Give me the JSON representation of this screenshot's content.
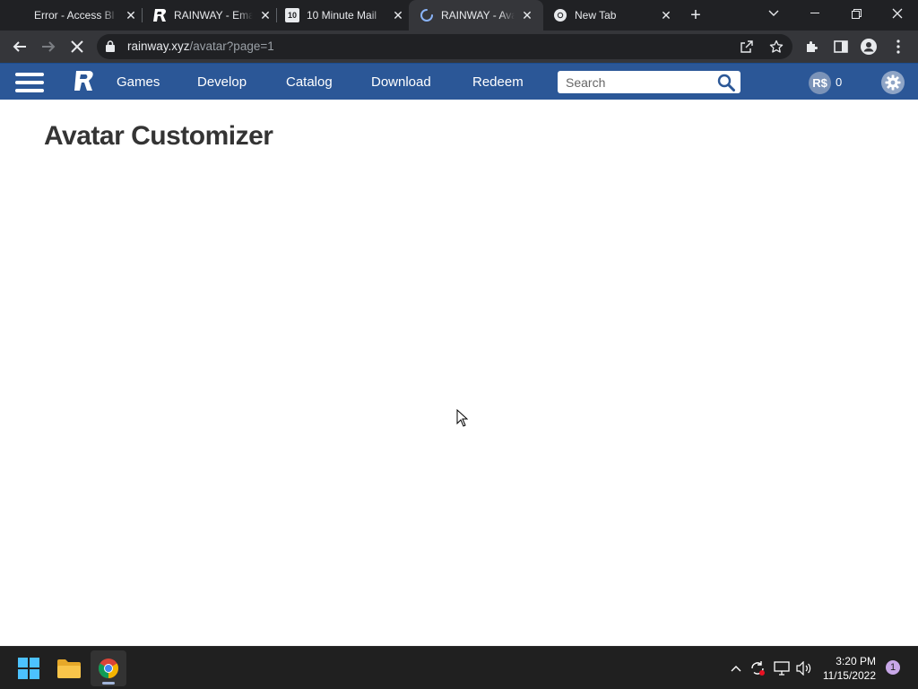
{
  "browser": {
    "tabs": [
      {
        "title": "Error - Access Bl",
        "favicon": "error-favicon"
      },
      {
        "title": "RAINWAY - Ema",
        "favicon": "rainway-favicon"
      },
      {
        "title": "10 Minute Mail",
        "favicon": "10minutemail-favicon",
        "favicon_text": "10"
      },
      {
        "title": "RAINWAY - Avat",
        "favicon": "loading-spinner"
      },
      {
        "title": "New Tab",
        "favicon": "chrome-favicon"
      }
    ],
    "active_tab_index": 3,
    "url_host": "rainway.xyz",
    "url_path": "/avatar?page=1"
  },
  "site": {
    "nav": [
      {
        "label": "Games"
      },
      {
        "label": "Develop"
      },
      {
        "label": "Catalog"
      },
      {
        "label": "Download"
      },
      {
        "label": "Redeem"
      }
    ],
    "search_placeholder": "Search",
    "currency_symbol": "R$",
    "currency_amount": "0",
    "brand_color": "#2b5797"
  },
  "page": {
    "title": "Avatar Customizer"
  },
  "taskbar": {
    "time": "3:20 PM",
    "date": "11/15/2022",
    "notification_count": "1"
  }
}
